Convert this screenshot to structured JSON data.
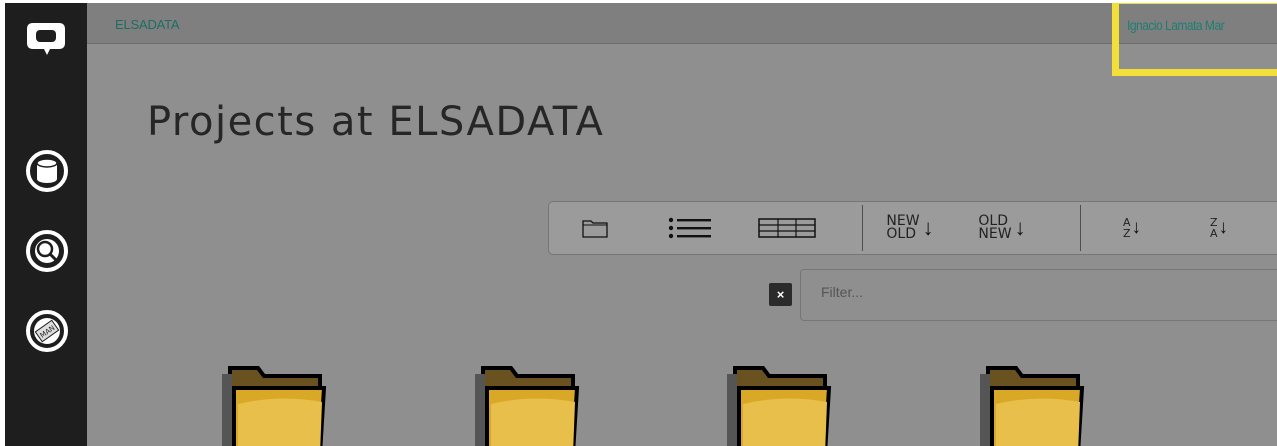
{
  "header": {
    "breadcrumb": "ELSADATA",
    "user_name": "Ignacio Lamata Mar"
  },
  "page": {
    "title": "Projects at ELSADATA"
  },
  "sort": {
    "new_old": {
      "line1": "NEW",
      "line2": "OLD",
      "arrow": "↓"
    },
    "old_new": {
      "line1": "OLD",
      "line2": "NEW",
      "arrow": "↓"
    },
    "a_z": {
      "line1": "A",
      "line2": "Z",
      "arrow": "↓"
    },
    "z_a": {
      "line1": "Z",
      "line2": "A",
      "arrow": "↓"
    }
  },
  "filter": {
    "placeholder": "Filter...",
    "clear_label": "×"
  },
  "sidebar": {
    "items": [
      {
        "icon": "logo-icon"
      },
      {
        "icon": "database-icon"
      },
      {
        "icon": "search-icon"
      },
      {
        "icon": "manual-icon",
        "label": "MAN"
      }
    ]
  },
  "colors": {
    "highlight": "#f3df3a",
    "accent_text": "#1f7d73",
    "sidebar_bg": "#1e1e1e",
    "main_bg": "#8f8f8f"
  },
  "projects": [
    {
      "icon": "folder-icon"
    },
    {
      "icon": "folder-icon"
    },
    {
      "icon": "folder-icon"
    },
    {
      "icon": "folder-icon"
    }
  ]
}
